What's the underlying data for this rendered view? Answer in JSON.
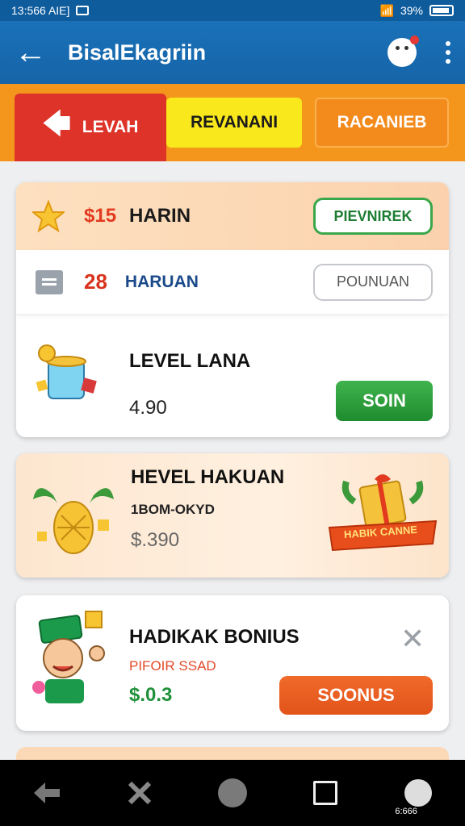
{
  "status": {
    "time": "13:566 AIE]",
    "battery": "39%"
  },
  "appbar": {
    "title": "BisalEkagriin"
  },
  "tabs": [
    {
      "label": "LEVAH"
    },
    {
      "label": "REVANANI"
    },
    {
      "label": "RACANIEB"
    }
  ],
  "card1": {
    "top_row": {
      "price": "$15",
      "label": "HARIN",
      "button": "PIEVNIREK"
    },
    "mid_row": {
      "number": "28",
      "label": "HARUAN",
      "button": "POUNUAN"
    },
    "bottom_row": {
      "title": "LEVEL LANA",
      "value": "4.90",
      "button": "SOIN"
    }
  },
  "card2": {
    "title": "HEVEL HAKUAN",
    "subtitle": "1BOM-OKYD",
    "price": "$.390",
    "badge": "HABIK CANNE"
  },
  "card3": {
    "title": "HADIKAK BONIUS",
    "subtitle": "PIFOIR SSAD",
    "price": "$.0.3",
    "button": "SOONUS",
    "close": "✕"
  },
  "navbar": {
    "avatar_label": "6:666"
  },
  "colors": {
    "appbar": "#1564a8",
    "tab_active": "#dd3329",
    "tab_yellow": "#f9e81b",
    "accent_green": "#20913a",
    "accent_orange": "#e2531a"
  }
}
